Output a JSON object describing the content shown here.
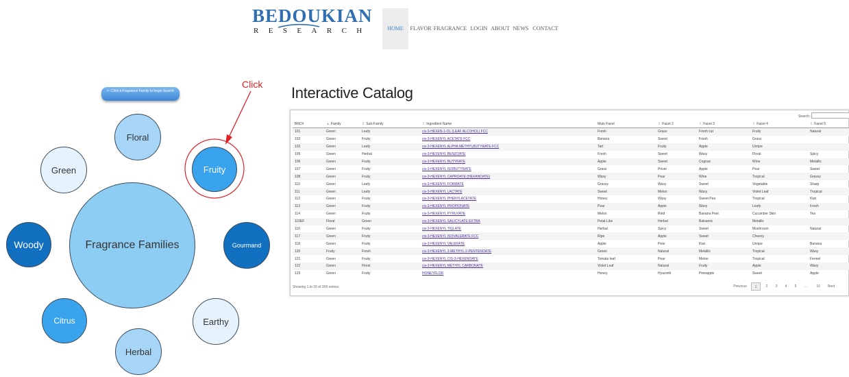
{
  "header": {
    "logo_main": "BEDOUKIAN",
    "logo_sub": "RESEARCH",
    "nav": [
      "HOME",
      "FLAVOR",
      "FRAGRANCE",
      "LOGIN",
      "ABOUT",
      "NEWS",
      "CONTACT"
    ],
    "active_nav": "HOME"
  },
  "bubbles": {
    "tip": "<- Click a Fragrance Family to begin Search",
    "center": "Fragrance Families",
    "floral": "Floral",
    "fruity": "Fruity",
    "green": "Green",
    "woody": "Woody",
    "gourmand": "Gourmand",
    "citrus": "Citrus",
    "earthy": "Earthy",
    "herbal": "Herbal",
    "click_annotation": "Click",
    "annotation_color": "#e01f26"
  },
  "catalog": {
    "title": "Interactive Catalog",
    "search_label": "Search:",
    "search_value": "",
    "columns": [
      "BRC#",
      "Family",
      "Sub-Family",
      "Ingredient Name",
      "Main Facet",
      "Facet 2",
      "Facet 3",
      "Facet 4",
      "Facet 5"
    ],
    "rows": [
      [
        "101",
        "Green",
        "Leafy",
        "cis-3-HEXEN-1-OL (LEAF ALCOHOL) FCC",
        "Fresh",
        "Grass",
        "Fresh cut",
        "Fruity",
        "Natural"
      ],
      [
        "102",
        "Green",
        "Fruity",
        "cis-3-HEXENYL ACETATE FCC",
        "Banana",
        "Sweet",
        "Fresh",
        "Grass",
        ""
      ],
      [
        "103",
        "Green",
        "Leafy",
        "cis-3-HEXENYL ALPHA METHYLBUTYRATE FCC",
        "Tart",
        "Fruity",
        "Apple",
        "Unripe",
        ""
      ],
      [
        "105",
        "Green",
        "Herbal",
        "cis-3-HEXENYL BENZOATE",
        "Fresh",
        "Sweet",
        "Waxy",
        "Floral",
        "Spicy"
      ],
      [
        "106",
        "Green",
        "Fruity",
        "cis-3-HEXENYL BUTYRATE",
        "Apple",
        "Sweet",
        "Cognac",
        "Wine",
        "Metallic"
      ],
      [
        "107",
        "Green",
        "Fruity",
        "cis-3-HEXENYL ISOBUTYRATE",
        "Grass",
        "Privet",
        "Apple",
        "Pear",
        "Sweet"
      ],
      [
        "108",
        "Green",
        "Fruity",
        "cis-3-HEXENYL CAPROATE (HEXANOATE)",
        "Waxy",
        "Pear",
        "Wine",
        "Tropical",
        "Grassy"
      ],
      [
        "110",
        "Green",
        "Leafy",
        "cis-3-HEXENYL FORMATE",
        "Grassy",
        "Waxy",
        "Sweet",
        "Vegetable",
        "Sharp"
      ],
      [
        "111",
        "Green",
        "Leafy",
        "cis-3-HEXENYL LACTATE",
        "Sweet",
        "Melon",
        "Waxy",
        "Violet Leaf",
        "Tropical"
      ],
      [
        "112",
        "Green",
        "Fruity",
        "cis-3-HEXENYL PHENYLACETATE",
        "Honey",
        "Waxy",
        "Sweet Pea",
        "Tropical",
        "Kiwi"
      ],
      [
        "113",
        "Green",
        "Fruity",
        "cis-3-HEXENYL PROPIONATE",
        "Pear",
        "Apple",
        "Waxy",
        "Leafy",
        "Fresh"
      ],
      [
        "114",
        "Green",
        "Fruity",
        "cis-3-HEXENYL PYRUVATE",
        "Melon",
        "Rind",
        "Banana Peel",
        "Cucumber Skin",
        "Tea"
      ],
      [
        "115EF",
        "Floral",
        "Green",
        "cis-3-HEXENYL SALICYLATE EXTRA",
        "Petal-Like",
        "Herbal",
        "Balsamic",
        "Metallic",
        ""
      ],
      [
        "116",
        "Green",
        "Fruity",
        "cis-3-HEXENYL TIGLATE",
        "Herbal",
        "Spicy",
        "Sweet",
        "Mushroom",
        "Natural"
      ],
      [
        "117",
        "Green",
        "Fruity",
        "cis-3-HEXENYL ISOVALERATE FCC",
        "Ripe",
        "Apple",
        "Sweet",
        "Cheesy",
        ""
      ],
      [
        "118",
        "Green",
        "Fruity",
        "cis-3-HEXENYL VALERATE",
        "Apple",
        "Pear",
        "Kiwi",
        "Unripe",
        "Banana"
      ],
      [
        "120",
        "Fruity",
        "Fresh",
        "cis-3-HEXENYL 2-METHYL-2-PENTENOATE",
        "Green",
        "Natural",
        "Metallic",
        "Tropical",
        "Waxy"
      ],
      [
        "121",
        "Green",
        "Fruity",
        "cis-3-HEXENYL CIS-3-HEXENOATE",
        "Tomato leaf",
        "Pear",
        "Melon",
        "Tropical",
        "Fennel"
      ],
      [
        "122",
        "Green",
        "Floral",
        "cis-3-HEXENYL METHYL CARBONATE",
        "Violet Leaf",
        "Natural",
        "Fruity",
        "Apple",
        "Waxy"
      ],
      [
        "123",
        "Green",
        "Fruity",
        "HONEYFLOR",
        "Honey",
        "Hyacinth",
        "Pineapple",
        "Sweet",
        "Apple"
      ]
    ],
    "info": "Showing 1 to 20 of 309 entries",
    "pager": {
      "previous": "Previous",
      "pages": [
        "1",
        "2",
        "3",
        "4",
        "5",
        "...",
        "16"
      ],
      "current": "1",
      "next": "Next"
    }
  }
}
